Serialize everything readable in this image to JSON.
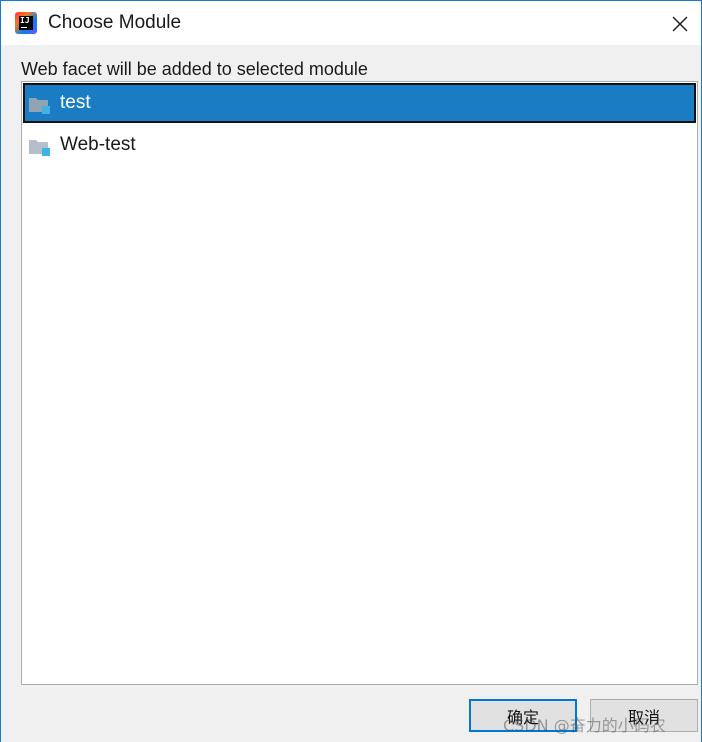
{
  "window": {
    "title": "Choose Module",
    "app_icon": "intellij-idea-icon",
    "close_icon": "close-icon"
  },
  "dialog": {
    "prompt": "Web facet will be added to selected module",
    "modules": [
      {
        "label": "test",
        "icon": "module-folder-icon",
        "selected": true
      },
      {
        "label": "Web-test",
        "icon": "module-folder-icon",
        "selected": false
      }
    ]
  },
  "buttons": {
    "ok_label": "确定",
    "cancel_label": "取消"
  },
  "watermark": "CSDN @奋力的小码农",
  "colors": {
    "selection": "#1a7cc3",
    "folder": "#8fa3b3",
    "module_badge": "#3fb4e3",
    "focus_border": "#0078d7"
  }
}
